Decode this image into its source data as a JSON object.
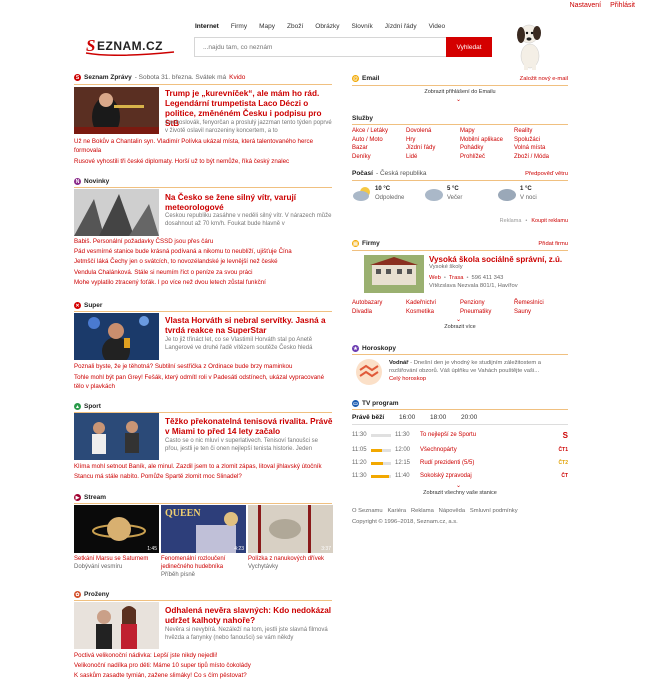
{
  "topbar": {
    "settings": "Nastavení",
    "login": "Přihlásit"
  },
  "nav": [
    "Internet",
    "Firmy",
    "Mapy",
    "Zboží",
    "Obrázky",
    "Slovník",
    "Jízdní řády",
    "Video"
  ],
  "search": {
    "placeholder": "...najdu tam, co neznám",
    "button": "Vyhledat"
  },
  "news_header": {
    "title": "Seznam Zprávy",
    "date": "- Sobota 31. března. Svátek má",
    "nameday": "Kvido"
  },
  "zpravy": {
    "headline": "Trump je „kurevníček“, ale mám ho rád. Legendární trumpetista Laco Déczi o politice, změnéném Česku i podpisu pro StB",
    "perex": "Čechoslovák, fenyorčan a proslulý jazzman tento týden poprvé v životě oslavil narozeniny koncertem, a to",
    "links": [
      "Už ne Bokův a Chantalin syn. Vladimír Polívka ukázal místa, která talentovaného herce formovala",
      "Rusové vyhostili tři české diplomaty. Horší už to být nemůže, říká český znalec"
    ]
  },
  "novinky": {
    "title": "Novinky",
    "headline": "Na Česko se žene silný vítr, varují meteorologové",
    "perex": "Českou republiku zasáhne v neděli silný vítr. V nárazech může dosahnout až 70 km/h. Foukat bude hlavně v",
    "links": [
      "Babiš. Personální požadavky ČSSD jsou přes čáru",
      "Pád vesmírné stanice bude krásná podívaná a nikomu to neublíží, ujišťuje Čína",
      "Jetmščí láká Čechy jen o svátcích, to novozélandské je levnější než české",
      "Vendula Chalánková. Stále si neumím říct o peníze za svou práci",
      "Mohe vyplatilo ztracený foťák. I po více než dvou letech zůstal funkční"
    ]
  },
  "super": {
    "title": "Super",
    "headline": "Vlasta Horváth si nebral servítky. Jasná a tvrdá reakce na SuperStar",
    "perex": "Je to již třináct let, co se Vlastimil Horváth stal po Anetě Langerové ve druhé řadě vítězem soutěže Česko hledá",
    "links": [
      "Poznali byste, že je těhotná? Subtilní sestřička z Ordinace bude brzy maminkou",
      "Tohle mohl být pan Grey! Fešák, který odmítl roli v Padesáti odstínech, ukázal vypracované tělo v plavkách"
    ]
  },
  "sport": {
    "title": "Sport",
    "headline": "Těžko překonatelná tenisová rivalita. Právě v Miami to před 14 lety začalo",
    "perex": "Často se o nic mluví v superlativech. Tenisoví fanoušci se přou, jestli je ten či onen nejlepší tenista historie. Jeden",
    "links": [
      "Klíma mohl setnout Baník, ale minul. Zazdil jsem to a zlomit zápas, litoval jihlavský útočník",
      "Stancu má stále nabíto. Pomůže Spartě zlomit moc Slinadel?"
    ]
  },
  "stream": {
    "title": "Stream",
    "videos": [
      {
        "title": "Setkání Marsu se Saturnem",
        "source": "Dobývání vesmíru",
        "time": "1:45"
      },
      {
        "title": "Fenomenální rozloučení jedinečného hudebníka",
        "source": "Příběh písně",
        "time": "4:23"
      },
      {
        "title": "Polízka z nanukových dřívek",
        "source": "Vychytávky",
        "time": "3:37"
      }
    ],
    "queen": "QUEEN"
  },
  "prozeny": {
    "title": "Proženy",
    "headline": "Odhalená nevěra slavných: Kdo nedokázal udržet kalhoty nahoře?",
    "perex": "Nevěra si nevybírá. Nezáleží na tom, jestli jste slavná filmová hvězda a fanynky (nebo fanoušci) se vám někdy",
    "links": [
      "Poctivá velikonoční nádivka: Lepší jste nikdy nejedli!",
      "Velikonoční nadílka pro děti: Máme 10 super tipů místo čokolády",
      "K saskům zasadte tymián, zažene slimáky! Co s čím pěstovat?"
    ]
  },
  "email": {
    "title": "Email",
    "setup": "Založit nový e-mail",
    "show": "Zobrazit přihlášení do Emailu"
  },
  "sluzby": {
    "title": "Služby",
    "cols": [
      [
        "Akce / Letáky",
        "Auto / Moto",
        "Bazar",
        "Deníky"
      ],
      [
        "Dovolená",
        "Hry",
        "Jízdní řády",
        "Lidé"
      ],
      [
        "Mapy",
        "Mobilní aplikace",
        "Pohádky",
        "Prohlížeč"
      ],
      [
        "Reality",
        "Spolužáci",
        "Volná místa",
        "Zboží / Móda"
      ]
    ]
  },
  "pocasi": {
    "title": "Počasí",
    "location": "- Česká republika",
    "forecast": "Předpověď větru",
    "items": [
      {
        "temp": "10 °C",
        "label": "Odpoledne"
      },
      {
        "temp": "5 °C",
        "label": "Večer"
      },
      {
        "temp": "1 °C",
        "label": "V noci"
      }
    ],
    "ad": "Reklama",
    "buy": "Koupit reklamu"
  },
  "firmy": {
    "title": "Firmy",
    "add": "Přidat firmu",
    "name": "Vysoká škola sociálně správní, z.ú.",
    "type": "Vysoké školy",
    "web": "Web",
    "route": "Trasa",
    "phone": "596 411 343",
    "address": "Vítězslava Nezvala 801/1, Havířov",
    "cats": [
      [
        "Autobazary",
        "Divadla"
      ],
      [
        "Kadeřnictví",
        "Kosmetika"
      ],
      [
        "Penziony",
        "Pneumatiky"
      ],
      [
        "Řemeslníci",
        "Sauny"
      ]
    ],
    "more": "Zobrazit více"
  },
  "horoskopy": {
    "title": "Horoskopy",
    "sign": "Vodnář",
    "text": "- Dnešní den je vhodný ke studijním záležitostem a rozšiřování obzorů. Váš úplňku ve Vahách pouštějte vaši...",
    "more": "Celý horoskop"
  },
  "tv": {
    "title": "TV program",
    "now": "Právě běží",
    "times": [
      "16:00",
      "18:00",
      "20:00"
    ],
    "rows": [
      {
        "start": "11:30",
        "end": "11:30",
        "show": "To nejlepší ze Sportu",
        "progress": 0.0,
        "ch": "S"
      },
      {
        "start": "11:05",
        "end": "12:00",
        "show": "Všechnopárty",
        "progress": 0.55,
        "ch": "ČT1"
      },
      {
        "start": "11:20",
        "end": "12:15",
        "show": "Rudí prezidenti (5/5)",
        "progress": 0.6,
        "ch": "ČT2"
      },
      {
        "start": "11:30",
        "end": "11:40",
        "show": "Sokolský zpravodaj",
        "progress": 0.9,
        "ch": "ČT"
      }
    ],
    "all": "Zobrazit všechny vaše stanice"
  },
  "footer": {
    "links": "O Seznamu   Kariéra   Reklama   Nápověda   Smluvní podmínky",
    "copy": "Copyright © 1996–2018, Seznam.cz, a.s."
  },
  "colors": {
    "accent": "#cc0000",
    "divider": "#f0c080"
  }
}
